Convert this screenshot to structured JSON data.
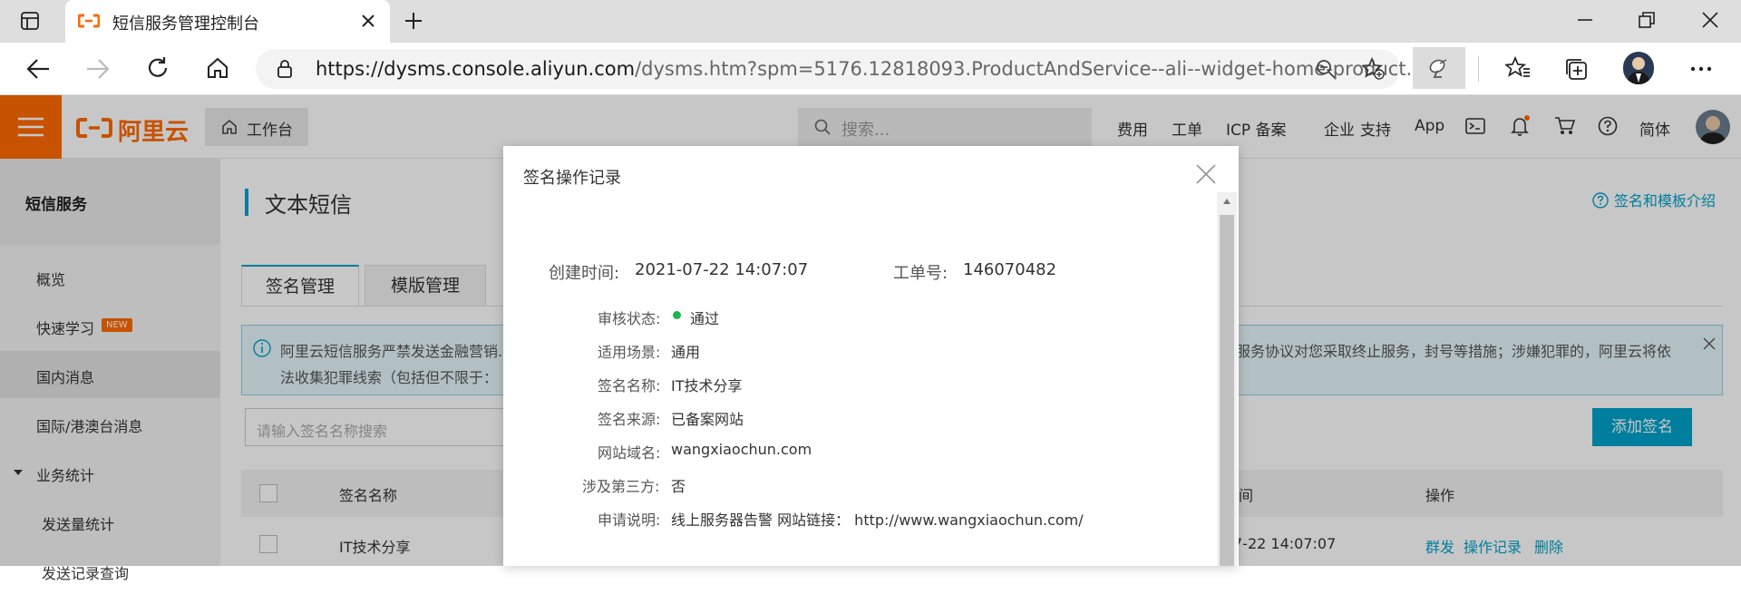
{
  "browser": {
    "tab_title": "短信服务管理控制台",
    "url_host": "https://dysms.console.aliyun.com",
    "url_rest": "/dysms.htm?spm=5176.12818093.ProductAndService--ali--widget-home-product..."
  },
  "console": {
    "logo": "阿里云",
    "workbench": "工作台",
    "search_placeholder": "搜索...",
    "nav": [
      "费用",
      "工单",
      "ICP 备案",
      "企业",
      "支持",
      "App"
    ],
    "lang": "简体"
  },
  "sidebar": {
    "header": "短信服务",
    "items": [
      {
        "label": "概览"
      },
      {
        "label": "快速学习",
        "badge": "NEW"
      },
      {
        "label": "国内消息"
      },
      {
        "label": "国际/港澳台消息"
      },
      {
        "label": "业务统计"
      },
      {
        "label": "发送量统计"
      },
      {
        "label": "发送记录查询"
      }
    ]
  },
  "main": {
    "title": "文本短信",
    "help": "签名和模板介绍",
    "tabs": [
      "签名管理",
      "模版管理"
    ],
    "notice": {
      "line1": "阿里云短信服务严禁发送金融营销...",
      "line2": "法收集犯罪线索（包括但不限于：",
      "line1_right": "服务协议对您采取终止服务，封号等措施；涉嫌犯罪的，阿里云将依"
    },
    "search_placeholder": "请输入签名名称搜索",
    "add_button": "添加签名",
    "table": {
      "headers": [
        "签名名称",
        "间",
        "操作"
      ],
      "rows": [
        {
          "name": "IT技术分享",
          "time": "7-22 14:07:07",
          "actions": [
            "群发",
            "操作记录",
            "删除"
          ]
        }
      ]
    }
  },
  "modal": {
    "title": "签名操作记录",
    "created_label": "创建时间:",
    "created_value": "2021-07-22 14:07:07",
    "ticket_label": "工单号:",
    "ticket_value": "146070482",
    "fields": [
      {
        "label": "审核状态:",
        "value": "通过"
      },
      {
        "label": "适用场景:",
        "value": "通用"
      },
      {
        "label": "签名名称:",
        "value": "IT技术分享"
      },
      {
        "label": "签名来源:",
        "value": "已备案网站"
      },
      {
        "label": "网站域名:",
        "value": "wangxiaochun.com"
      },
      {
        "label": "涉及第三方:",
        "value": "否"
      },
      {
        "label": "申请说明:",
        "value": "线上服务器告警 网站链接： http://www.wangxiaochun.com/"
      }
    ]
  },
  "colors": {
    "accent": "#00a2ca",
    "brand": "#ff6a00",
    "status_ok": "#1eb34e"
  }
}
